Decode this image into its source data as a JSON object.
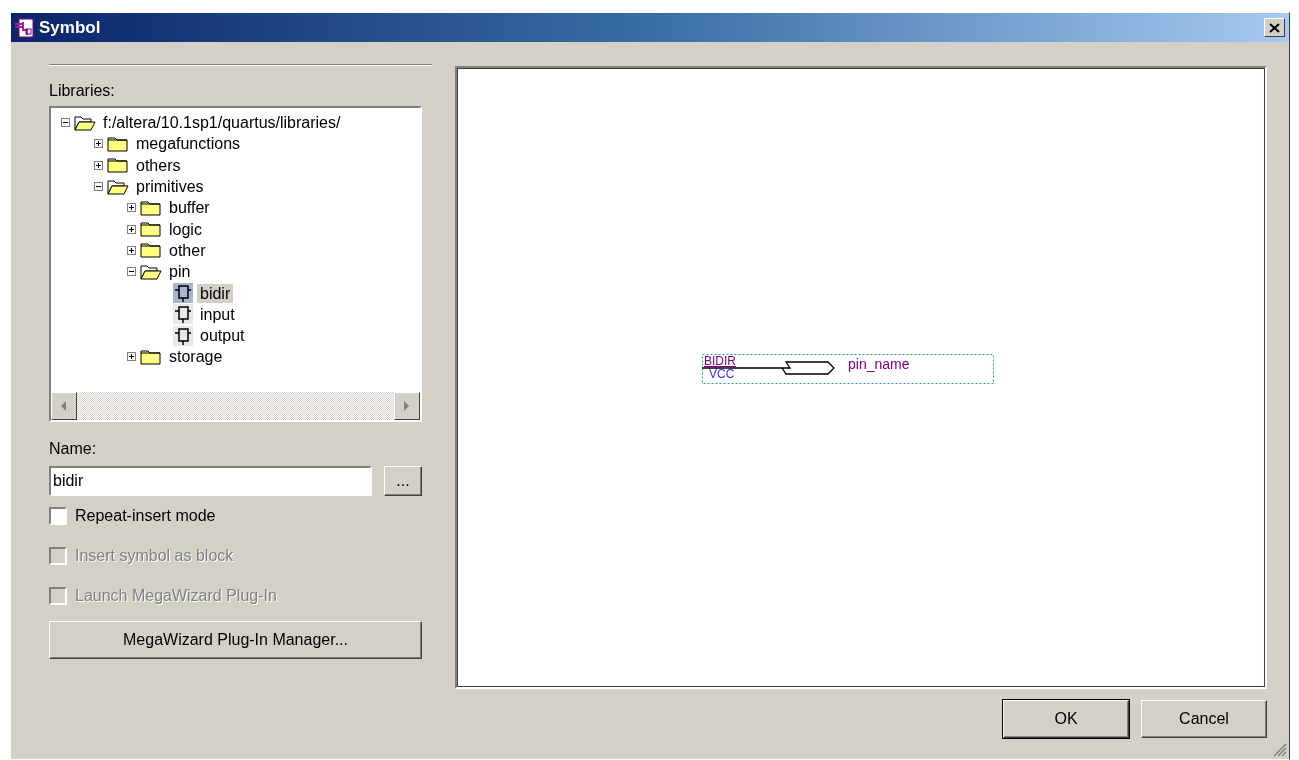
{
  "window": {
    "title": "Symbol"
  },
  "libraries": {
    "label": "Libraries:",
    "tree": [
      {
        "label": "f:/altera/10.1sp1/quartus/libraries/",
        "kind": "folder",
        "expanded": true,
        "selected": false,
        "children": [
          {
            "label": "megafunctions",
            "kind": "folder",
            "expanded": false,
            "selected": false
          },
          {
            "label": "others",
            "kind": "folder",
            "expanded": false,
            "selected": false
          },
          {
            "label": "primitives",
            "kind": "folder",
            "expanded": true,
            "selected": false,
            "children": [
              {
                "label": "buffer",
                "kind": "folder",
                "expanded": false,
                "selected": false
              },
              {
                "label": "logic",
                "kind": "folder",
                "expanded": false,
                "selected": false
              },
              {
                "label": "other",
                "kind": "folder",
                "expanded": false,
                "selected": false
              },
              {
                "label": "pin",
                "kind": "folder",
                "expanded": true,
                "selected": false,
                "children": [
                  {
                    "label": "bidir",
                    "kind": "symbol",
                    "selected": true
                  },
                  {
                    "label": "input",
                    "kind": "symbol",
                    "selected": false
                  },
                  {
                    "label": "output",
                    "kind": "symbol",
                    "selected": false
                  }
                ]
              },
              {
                "label": "storage",
                "kind": "folder",
                "expanded": false,
                "selected": false
              }
            ]
          }
        ]
      }
    ]
  },
  "name": {
    "label": "Name:",
    "value": "bidir",
    "browse": "..."
  },
  "options": [
    {
      "label": "Repeat-insert mode",
      "checked": false,
      "disabled": false
    },
    {
      "label": "Insert symbol as block",
      "checked": false,
      "disabled": true
    },
    {
      "label": "Launch MegaWizard Plug-In",
      "checked": false,
      "disabled": true
    }
  ],
  "manager_button": "MegaWizard Plug-In Manager...",
  "preview": {
    "symbol": {
      "type_label": "BIDIR",
      "default_label": "VCC",
      "pin_label": "pin_name"
    }
  },
  "buttons": [
    "OK",
    "Cancel"
  ]
}
